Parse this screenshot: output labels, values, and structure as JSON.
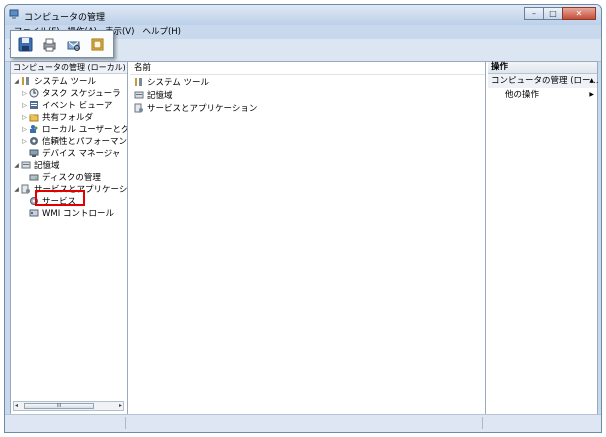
{
  "window": {
    "title": "コンピュータの管理",
    "buttons": {
      "minimize": "–",
      "maximize": "□",
      "close": "✕"
    }
  },
  "menu": [
    "ファイル(F)",
    "操作(A)",
    "表示(V)",
    "ヘルプ(H)"
  ],
  "toolbar": {
    "back": "◂",
    "icons": [
      "save-icon",
      "print-icon",
      "print-preview-icon",
      "properties-icon"
    ]
  },
  "tree": {
    "header": "コンピュータの管理 (ローカル)",
    "items": [
      {
        "label": "システム ツール",
        "expander": "◢",
        "icon": "tools-icon"
      },
      {
        "label": "タスク スケジューラ",
        "expander": "▷",
        "icon": "clock-icon"
      },
      {
        "label": "イベント ビューア",
        "expander": "▷",
        "icon": "event-viewer-icon"
      },
      {
        "label": "共有フォルダ",
        "expander": "▷",
        "icon": "shared-folder-icon"
      },
      {
        "label": "ローカル ユーザーとグループ",
        "expander": "▷",
        "icon": "users-icon"
      },
      {
        "label": "信頼性とパフォーマンス",
        "expander": "▷",
        "icon": "performance-icon"
      },
      {
        "label": "デバイス マネージャ",
        "expander": "",
        "icon": "device-manager-icon"
      },
      {
        "label": "記憶域",
        "expander": "◢",
        "icon": "storage-icon"
      },
      {
        "label": "ディスクの管理",
        "expander": "",
        "icon": "disk-icon"
      },
      {
        "label": "サービスとアプリケーション",
        "expander": "◢",
        "icon": "services-apps-icon"
      },
      {
        "label": "サービス",
        "expander": "",
        "icon": "services-icon"
      },
      {
        "label": "WMI コントロール",
        "expander": "",
        "icon": "wmi-icon"
      }
    ],
    "scroll_thumb": "III"
  },
  "list": {
    "column": "名前",
    "items": [
      {
        "label": "システム ツール",
        "icon": "tools-icon"
      },
      {
        "label": "記憶域",
        "icon": "storage-icon"
      },
      {
        "label": "サービスとアプリケーション",
        "icon": "services-apps-icon"
      }
    ]
  },
  "actions": {
    "header": "操作",
    "section": "コンピュータの管理 (ロー...",
    "section_arrow": "▲",
    "items": [
      {
        "label": "他の操作",
        "arrow": "▶"
      }
    ]
  },
  "colors": {
    "highlight": "#e00000",
    "chrome": "#c8d9ee"
  }
}
